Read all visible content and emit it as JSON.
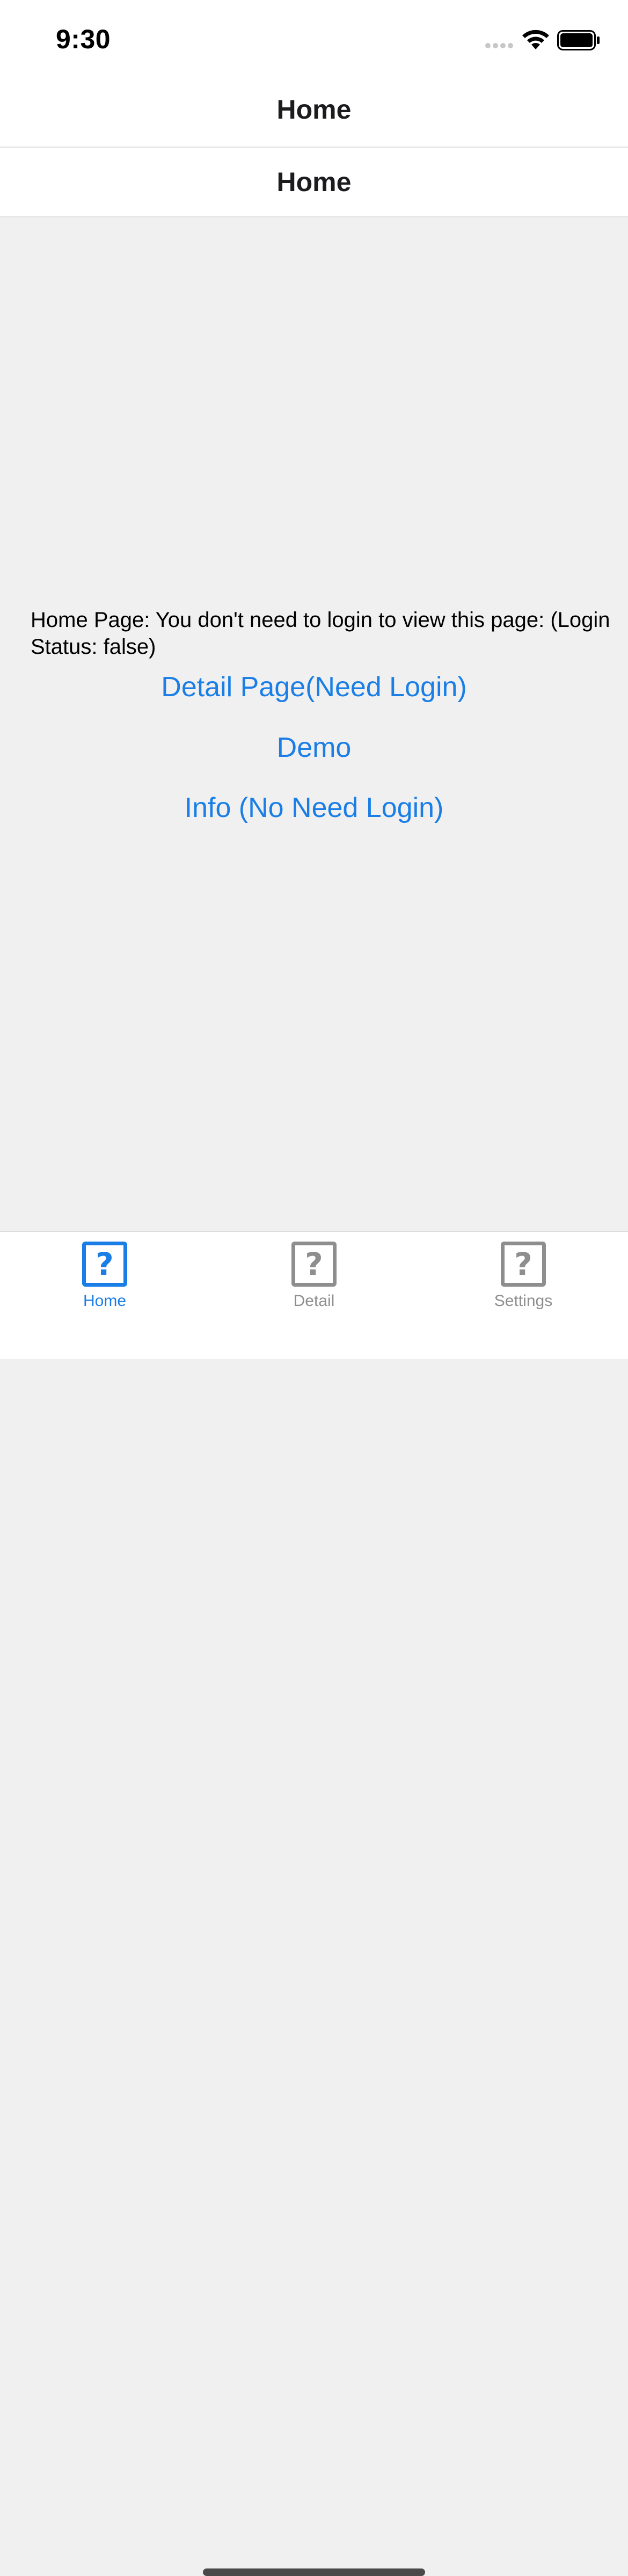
{
  "status_bar": {
    "time": "9:30"
  },
  "header": {
    "title": "Home",
    "subtitle": "Home"
  },
  "main": {
    "description": "Home Page: You don't need to login to view this page: (Login Status: false)",
    "links": {
      "detail": "Detail Page(Need Login)",
      "demo": "Demo",
      "info": "Info (No Need Login)"
    }
  },
  "tabs": [
    {
      "label": "Home",
      "icon": "question-square-icon",
      "active": true
    },
    {
      "label": "Detail",
      "icon": "question-square-icon",
      "active": false
    },
    {
      "label": "Settings",
      "icon": "question-square-icon",
      "active": false
    }
  ],
  "colors": {
    "accent": "#1a7ee6",
    "inactive": "#8e8e8e",
    "background": "#f0f0f0"
  },
  "icons": {
    "signal": "signal-icon",
    "wifi": "wifi-icon",
    "battery": "battery-icon"
  }
}
